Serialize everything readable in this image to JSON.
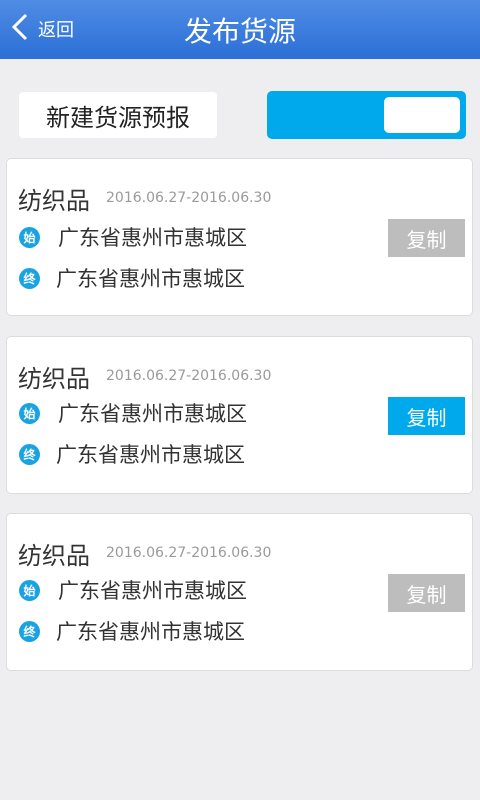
{
  "header": {
    "back_label": "返回",
    "title": "发布货源"
  },
  "toolbar": {
    "new_forecast_label": "新建货源预报"
  },
  "cards": [
    {
      "name": "纺织品",
      "date_range": "2016.06.27-2016.06.30",
      "start_icon": "始",
      "start_location": "广东省惠州市惠城区",
      "end_icon": "终",
      "end_location": "广东省惠州市惠城区",
      "copy_label": "复制",
      "copy_state": "disabled"
    },
    {
      "name": "纺织品",
      "date_range": "2016.06.27-2016.06.30",
      "start_icon": "始",
      "start_location": "广东省惠州市惠城区",
      "end_icon": "终",
      "end_location": "广东省惠州市惠城区",
      "copy_label": "复制",
      "copy_state": "active"
    },
    {
      "name": "纺织品",
      "date_range": "2016.06.27-2016.06.30",
      "start_icon": "始",
      "start_location": "广东省惠州市惠城区",
      "end_icon": "终",
      "end_location": "广东省惠州市惠城区",
      "copy_label": "复制",
      "copy_state": "disabled"
    }
  ],
  "colors": {
    "header": "#2b6fd6",
    "accent": "#00a8ec",
    "disabled": "#bdbdbd",
    "background": "#eeeef0"
  }
}
